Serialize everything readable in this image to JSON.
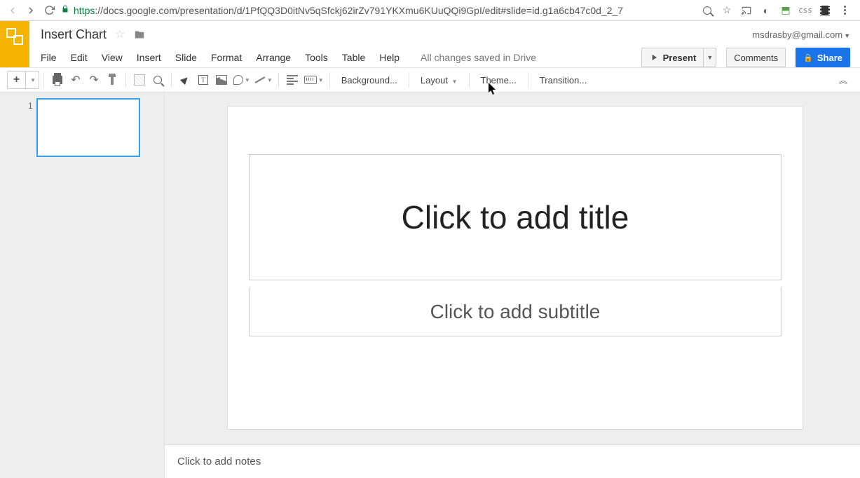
{
  "browser": {
    "url_secure": "https",
    "url_rest": "://docs.google.com/presentation/d/1PfQQ3D0itNv5qSfckj62irZv791YKXmu6KUuQQi9GpI/edit#slide=id.g1a6cb47c0d_2_7"
  },
  "header": {
    "doc_title": "Insert Chart",
    "user_email": "msdrasby@gmail.com",
    "present_label": "Present",
    "comments_label": "Comments",
    "share_label": "Share"
  },
  "menus": [
    "File",
    "Edit",
    "View",
    "Insert",
    "Slide",
    "Format",
    "Arrange",
    "Tools",
    "Table",
    "Help"
  ],
  "save_status": "All changes saved in Drive",
  "toolbar_text": {
    "background": "Background...",
    "layout": "Layout",
    "theme": "Theme...",
    "transition": "Transition..."
  },
  "thumbs": {
    "first_index": "1"
  },
  "slide": {
    "title_placeholder": "Click to add title",
    "subtitle_placeholder": "Click to add subtitle"
  },
  "notes": {
    "placeholder": "Click to add notes"
  }
}
